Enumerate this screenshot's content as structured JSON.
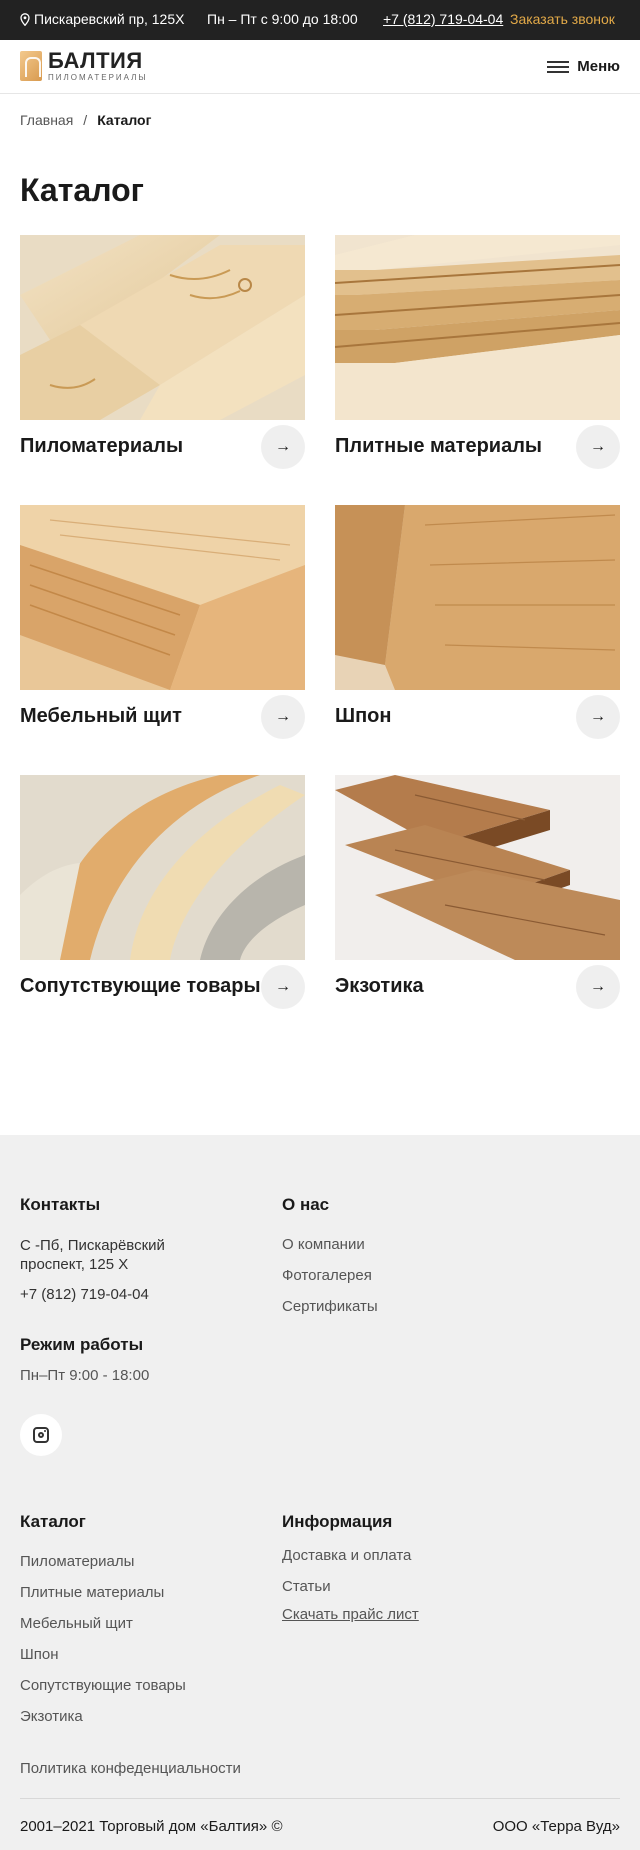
{
  "topbar": {
    "address": "Пискаревский пр, 125Х",
    "hours": "Пн – Пт с 9:00 до 18:00",
    "phone": "+7 (812) 719-04-04",
    "callback": "Заказать звонок",
    "accent_color": "#e2a948"
  },
  "header": {
    "logo_title": "БАЛТИЯ",
    "logo_subtitle": "ПИЛОМАТЕРИАЛЫ",
    "menu_label": "Меню"
  },
  "breadcrumb": {
    "home": "Главная",
    "separator": "/",
    "current": "Каталог"
  },
  "page_title": "Каталог",
  "catalog": [
    {
      "name": "Пиломатериалы",
      "icon": "arrow-right-icon"
    },
    {
      "name": "Плитные материалы",
      "icon": "arrow-right-icon"
    },
    {
      "name": "Мебельный щит",
      "icon": "arrow-right-icon"
    },
    {
      "name": "Шпон",
      "icon": "arrow-right-icon"
    },
    {
      "name": "Сопутствующие товары",
      "icon": "arrow-right-icon"
    },
    {
      "name": "Экзотика",
      "icon": "arrow-right-icon"
    }
  ],
  "footer": {
    "contacts_title": "Контакты",
    "address_line1": "С -Пб, Пискарёвский",
    "address_line2": "проспект, 125 Х",
    "phone": "+7 (812) 719-04-04",
    "hours_title": "Режим работы",
    "hours": "Пн–Пт  9:00 - 18:00",
    "about_title": "О нас",
    "about_links": [
      "О компании",
      "Фотогалерея",
      "Сертификаты"
    ],
    "catalog_title": "Каталог",
    "catalog_links": [
      "Пиломатериалы",
      "Плитные материалы",
      "Мебельный щит",
      "Шпон",
      "Сопутствующие товары",
      "Экзотика"
    ],
    "info_title": "Информация",
    "info_links": [
      "Доставка и оплата",
      "Статьи",
      "Скачать прайс лист"
    ],
    "policy": "Политика конфеденциальности",
    "copyright": "2001–2021 Торговый дом «Балтия» ©",
    "company": "ООО «Терра Вуд»",
    "background": "#f0f0f0"
  }
}
